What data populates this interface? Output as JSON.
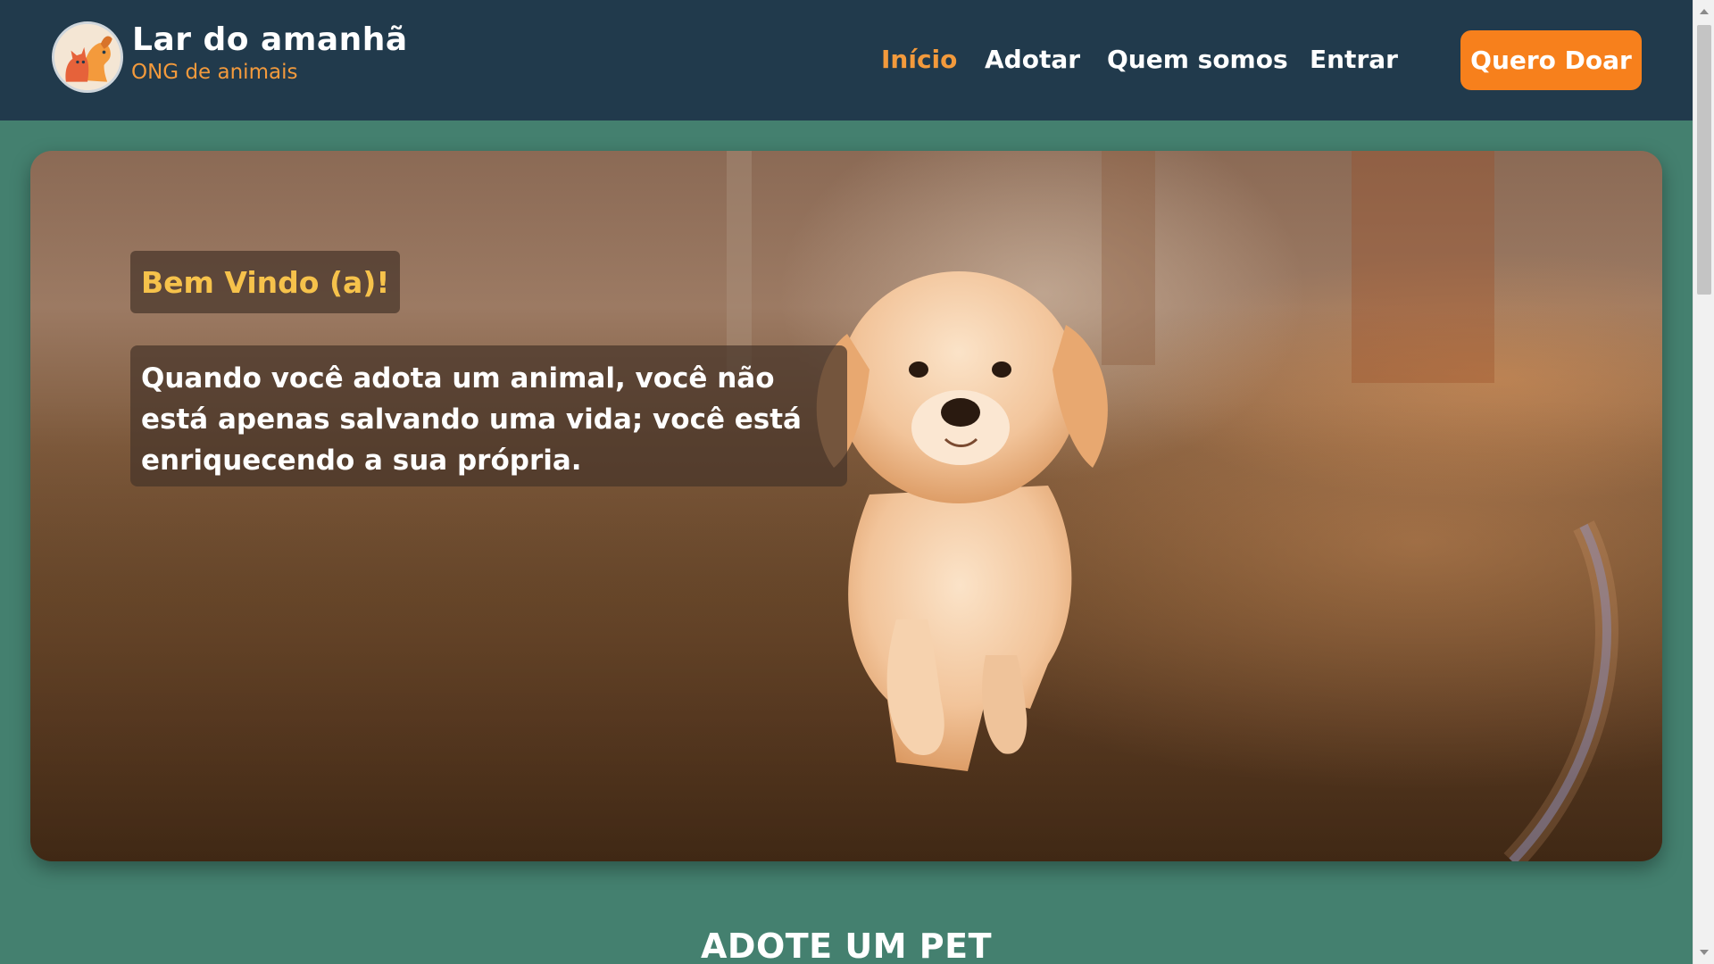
{
  "brand": {
    "title": "Lar do amanhã",
    "subtitle": "ONG de animais"
  },
  "nav": {
    "items": [
      {
        "label": "Início",
        "active": true
      },
      {
        "label": "Adotar",
        "active": false
      },
      {
        "label": "Quem somos",
        "active": false
      },
      {
        "label": "Entrar",
        "active": false
      }
    ],
    "cta_label": "Quero Doar"
  },
  "hero": {
    "welcome": "Bem Vindo (a)!",
    "quote": "Quando você adota um animal, você não está apenas salvando uma vida; você está enriquecendo a sua própria."
  },
  "section": {
    "title": "ADOTE UM PET"
  },
  "colors": {
    "header_bg": "#213a4c",
    "page_bg": "#44806f",
    "accent": "#f39a3c",
    "cta_bg": "#f7801c",
    "welcome_text": "#f6c24b"
  },
  "icons": {
    "logo": "cat-and-dog-logo-icon"
  }
}
